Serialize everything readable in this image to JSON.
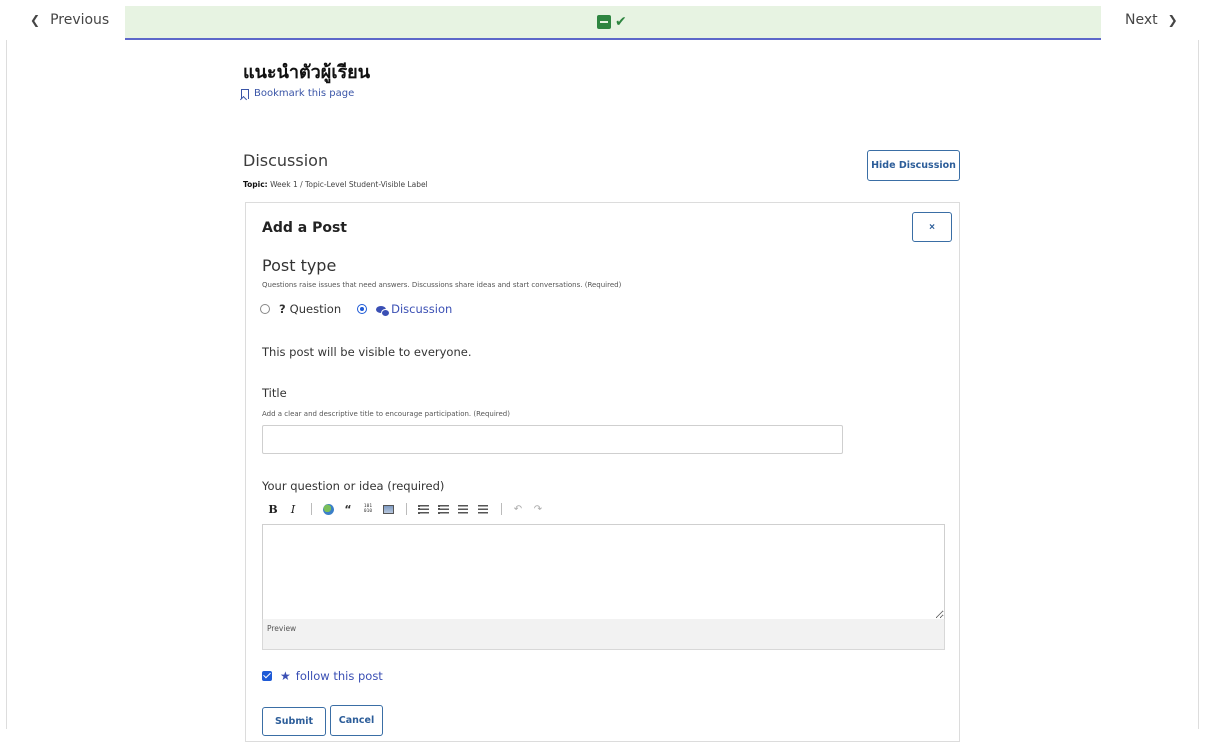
{
  "sequence_nav": {
    "previous_label": "Previous",
    "next_label": "Next",
    "unit_icons": [
      "book-icon",
      "check-icon"
    ],
    "completed_color": "#2e8540",
    "active_bar_color": "#e7f3e2"
  },
  "unit": {
    "title": "แนะนำตัวผู้เรียน",
    "bookmark_label": "Bookmark this page"
  },
  "discussion": {
    "heading": "Discussion",
    "topic_label": "Topic:",
    "topic_value": "Week 1 / Topic-Level Student-Visible Label",
    "hide_button": "Hide Discussion"
  },
  "add_post": {
    "heading": "Add a Post",
    "close_glyph": "×",
    "post_type": {
      "title": "Post type",
      "help": "Questions raise issues that need answers. Discussions share ideas and start conversations. (Required)",
      "options": [
        {
          "label": "Question",
          "glyph": "?",
          "selected": false
        },
        {
          "label": "Discussion",
          "selected": true
        }
      ]
    },
    "visibility_note": "This post will be visible to everyone.",
    "title_field": {
      "label": "Title",
      "help": "Add a clear and descriptive title to encourage participation. (Required)",
      "value": ""
    },
    "body_field": {
      "label": "Your question or idea (required)",
      "value": "",
      "toolbar": [
        "bold-icon",
        "italic-icon",
        "link-icon",
        "blockquote-icon",
        "code-icon",
        "image-icon",
        "numbered-list-icon",
        "bulleted-list-icon",
        "heading-icon",
        "horizontal-rule-icon",
        "undo-icon",
        "redo-icon"
      ],
      "preview_label": "Preview"
    },
    "follow": {
      "label": "follow this post",
      "checked": true
    },
    "submit_label": "Submit",
    "cancel_label": "Cancel"
  }
}
